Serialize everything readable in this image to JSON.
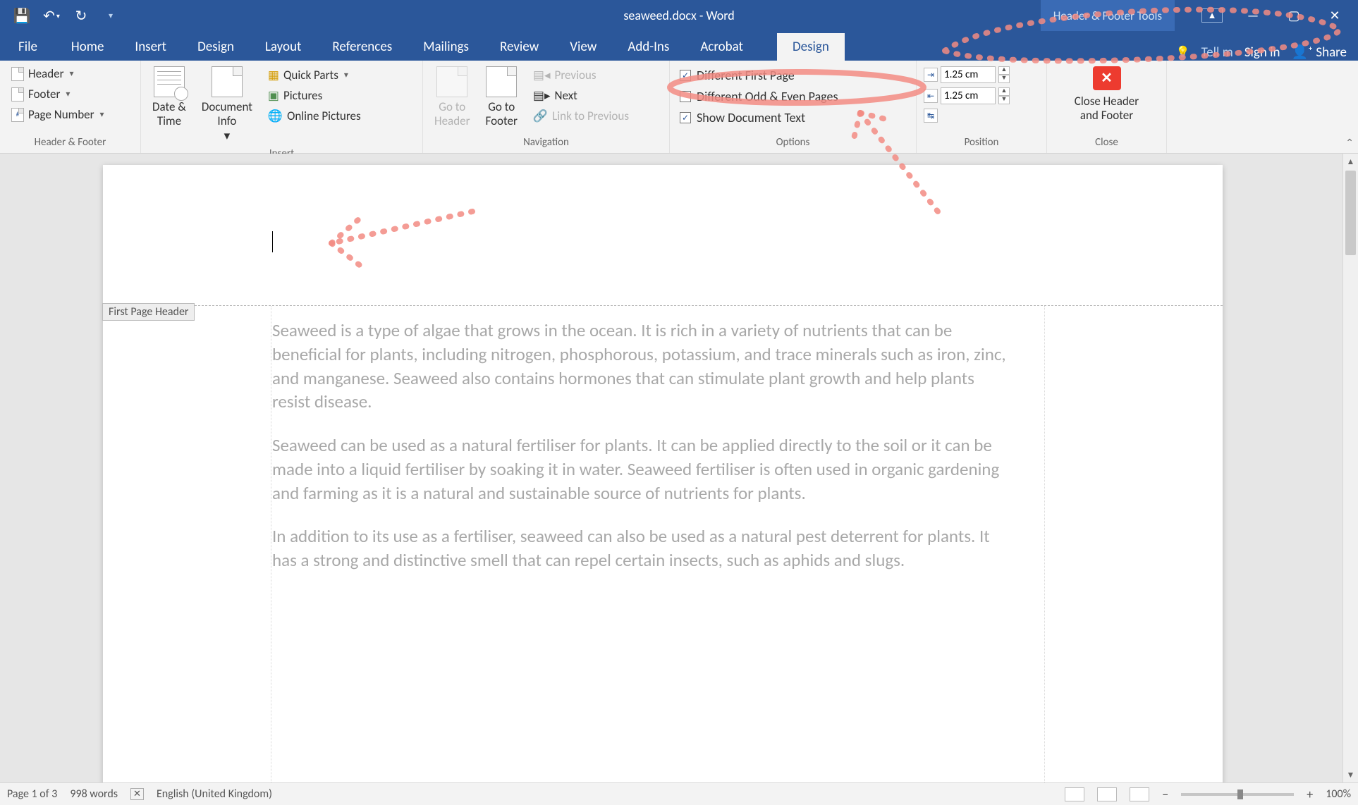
{
  "title": "seaweed.docx - Word",
  "contextual_tab": "Header & Footer Tools",
  "window_buttons": {
    "display_opts": "▭",
    "min": "—",
    "max": "▢",
    "close": "✕"
  },
  "tabs": {
    "file": "File",
    "home": "Home",
    "insert": "Insert",
    "design": "Design",
    "layout": "Layout",
    "references": "References",
    "mailings": "Mailings",
    "review": "Review",
    "view": "View",
    "addins": "Add-Ins",
    "acrobat": "Acrobat",
    "hf_design": "Design"
  },
  "tell_me": "Tell m",
  "sign_in": "Sign in",
  "share": "Share",
  "ribbon": {
    "header_footer": {
      "header": "Header",
      "footer": "Footer",
      "page_number": "Page Number",
      "label": "Header & Footer"
    },
    "insert": {
      "date_time": "Date &\nTime",
      "doc_info": "Document\nInfo",
      "quick_parts": "Quick Parts",
      "pictures": "Pictures",
      "online_pictures": "Online Pictures",
      "label": "Insert"
    },
    "navigation": {
      "goto_header": "Go to\nHeader",
      "goto_footer": "Go to\nFooter",
      "previous": "Previous",
      "next": "Next",
      "link_prev": "Link to Previous",
      "label": "Navigation"
    },
    "options": {
      "diff_first": "Different First Page",
      "diff_odd_even": "Different Odd & Even Pages",
      "show_doc_text": "Show Document Text",
      "label": "Options"
    },
    "position": {
      "top": "1.25 cm",
      "bottom": "1.25 cm",
      "label": "Position"
    },
    "close": {
      "close": "Close Header\nand Footer",
      "label": "Close"
    }
  },
  "header_tag": "First Page Header",
  "body": {
    "p1": "Seaweed is a type of algae that grows in the ocean. It is rich in a variety of nutrients that can be beneficial for plants, including nitrogen, phosphorous, potassium, and trace minerals such as iron, zinc, and manganese. Seaweed also contains hormones that can stimulate plant growth and help plants resist disease.",
    "p2": "Seaweed can be used as a natural fertiliser for plants. It can be applied directly to the soil or it can be made into a liquid fertiliser by soaking it in water. Seaweed fertiliser is often used in organic gardening and farming as it is a natural and sustainable source of nutrients for plants.",
    "p3": "In addition to its use as a fertiliser, seaweed can also be used as a natural pest deterrent for plants. It has a strong and distinctive smell that can repel certain insects, such as aphids and slugs."
  },
  "status": {
    "page": "Page 1 of 3",
    "words": "998 words",
    "lang": "English (United Kingdom)",
    "zoom": "100%"
  }
}
